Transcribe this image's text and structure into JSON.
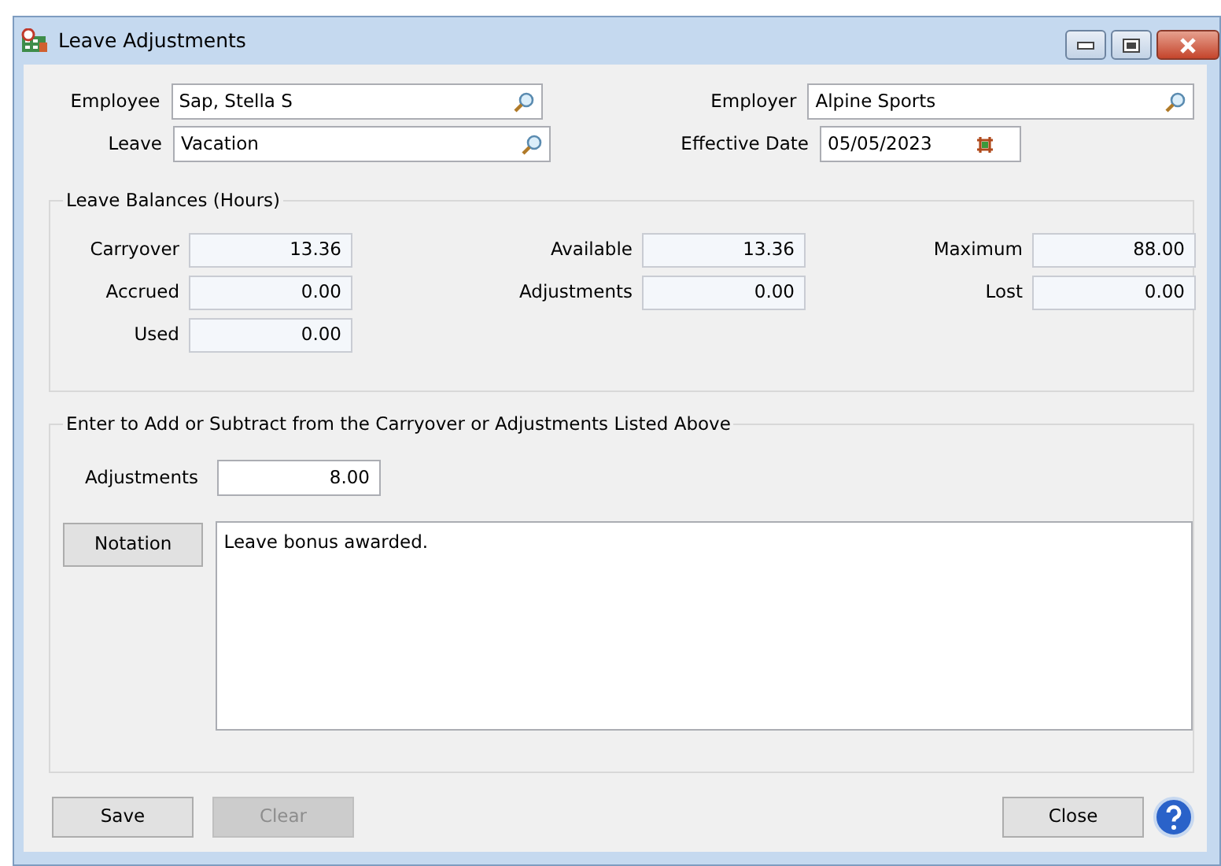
{
  "window": {
    "title": "Leave Adjustments"
  },
  "top_fields": [
    {
      "label": "Employee",
      "value": "Sap, Stella S",
      "kind": "lookup"
    },
    {
      "label": "Employer",
      "value": "Alpine Sports",
      "kind": "lookup"
    },
    {
      "label": "Leave",
      "value": "Vacation",
      "kind": "lookup"
    },
    {
      "label": "Effective Date",
      "value": "05/05/2023",
      "kind": "date"
    }
  ],
  "balances": {
    "title": "Leave Balances (Hours)",
    "columns": [
      [
        {
          "label": "Carryover",
          "value": "13.36"
        },
        {
          "label": "Accrued",
          "value": "0.00"
        },
        {
          "label": "Used",
          "value": "0.00"
        }
      ],
      [
        {
          "label": "Available",
          "value": "13.36"
        },
        {
          "label": "Adjustments",
          "value": "0.00"
        }
      ],
      [
        {
          "label": "Maximum",
          "value": "88.00"
        },
        {
          "label": "Lost",
          "value": "0.00"
        }
      ]
    ]
  },
  "entry": {
    "title": "Enter to Add or Subtract from the Carryover or Adjustments Listed Above",
    "adjustments_label": "Adjustments",
    "adjustments_value": "8.00",
    "notation_button": "Notation",
    "notation_value": "Leave bonus awarded."
  },
  "left_buttons": [
    {
      "label": "Save",
      "disabled": false
    },
    {
      "label": "Clear",
      "disabled": true
    }
  ],
  "right_buttons": [
    {
      "label": "Close",
      "disabled": false
    }
  ]
}
